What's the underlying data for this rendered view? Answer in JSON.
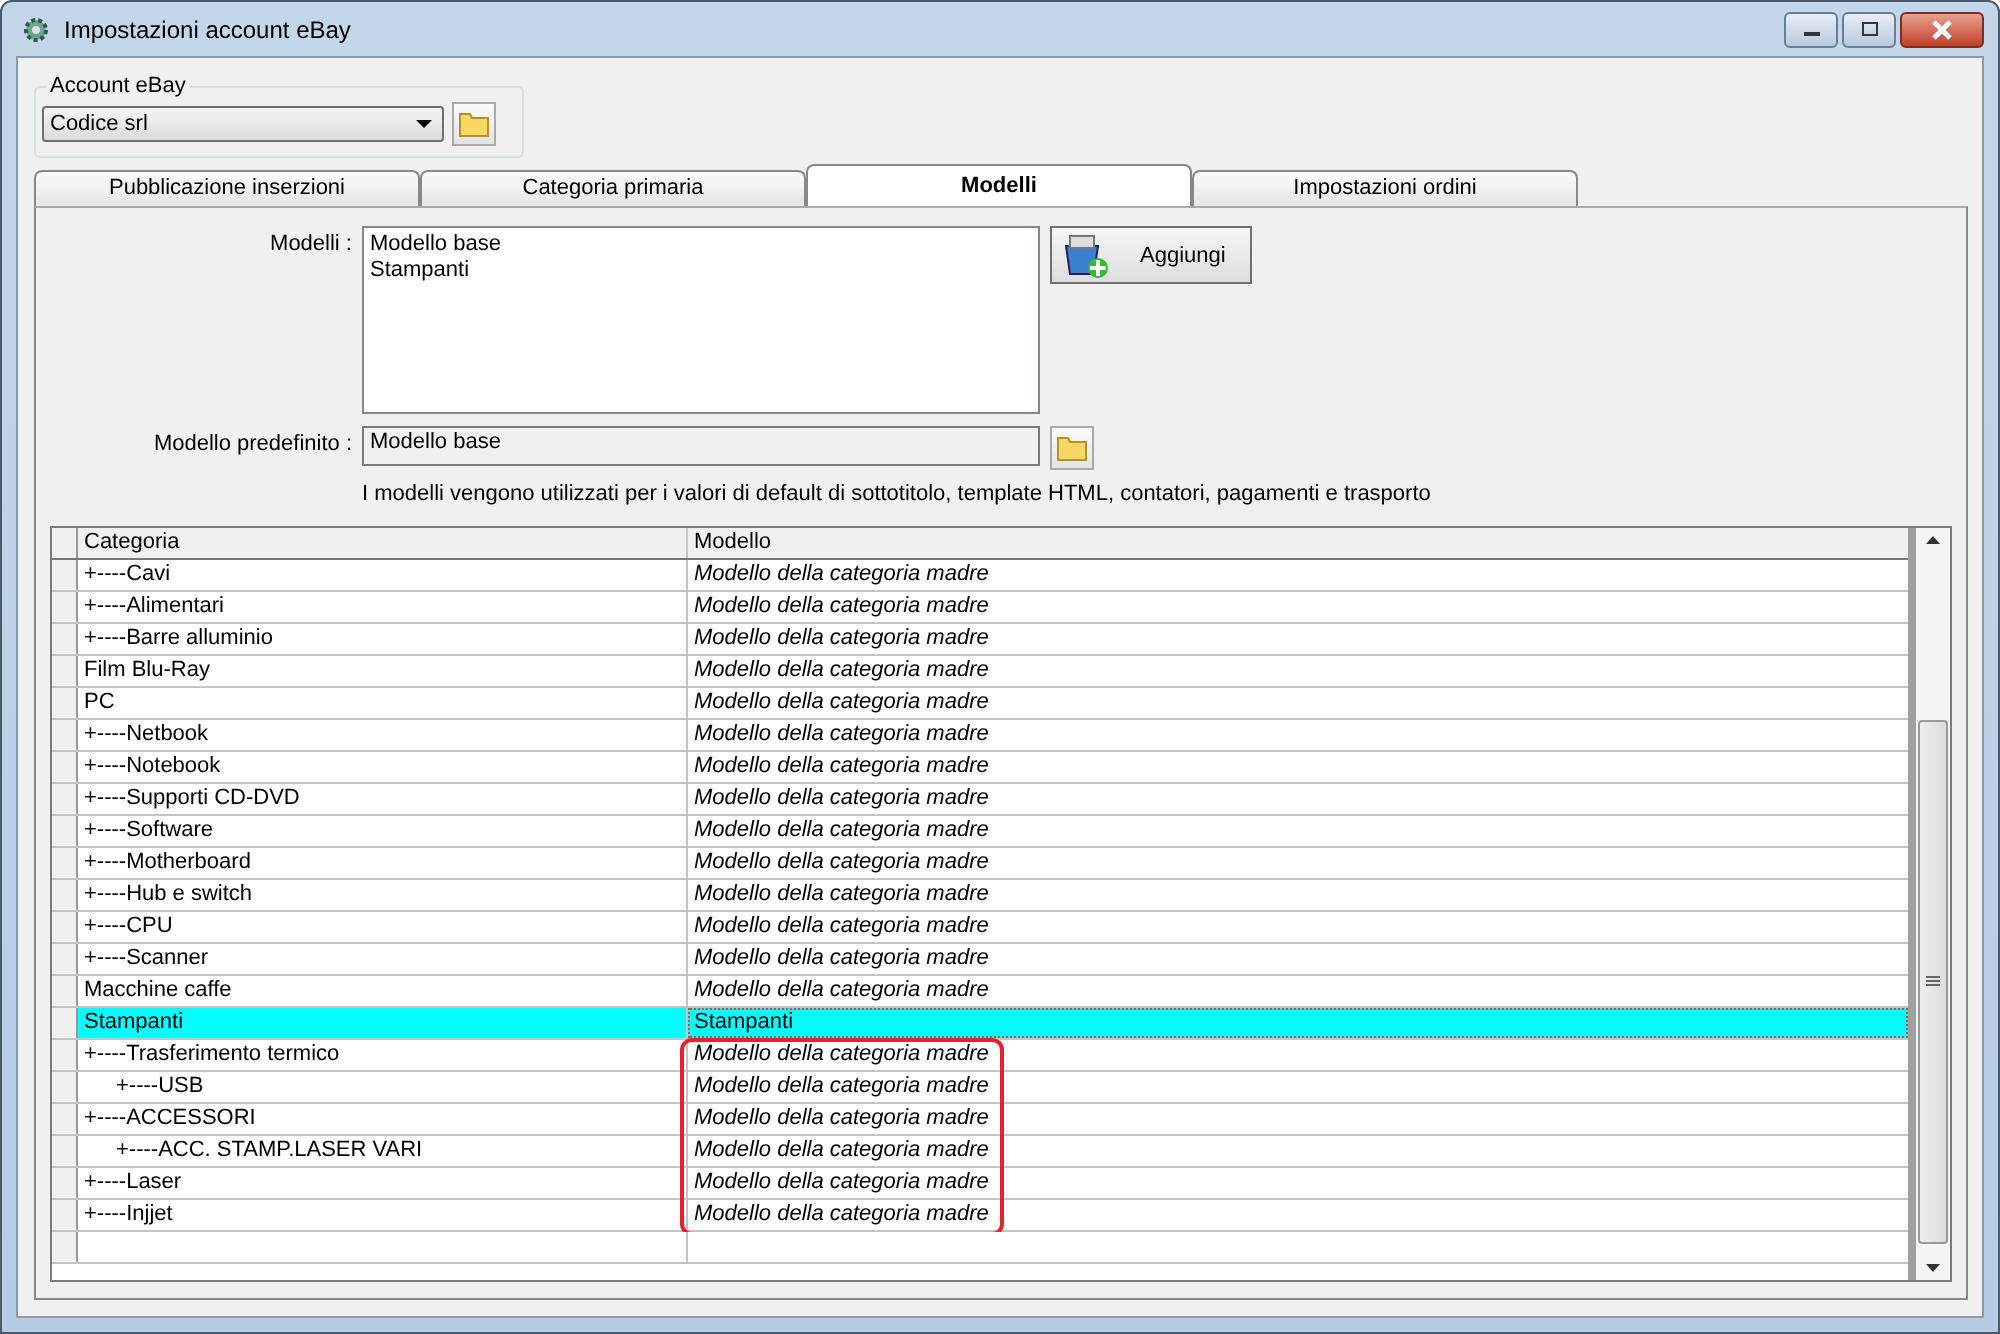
{
  "window": {
    "title": "Impostazioni account eBay"
  },
  "account_group": {
    "legend": "Account eBay",
    "account_select": {
      "value": "Codice srl"
    }
  },
  "tabs": [
    {
      "label": "Pubblicazione inserzioni",
      "selected": false
    },
    {
      "label": "Categoria primaria",
      "selected": false
    },
    {
      "label": "Modelli",
      "selected": true
    },
    {
      "label": "Impostazioni ordini",
      "selected": false
    }
  ],
  "models_panel": {
    "models_label": "Modelli :",
    "models_list": [
      "Modello base",
      "Stampanti"
    ],
    "add_button": "Aggiungi",
    "default_label": "Modello predefinito :",
    "default_value": "Modello base",
    "note": "I modelli vengono utilizzati per i valori di default di sottotitolo, template HTML, contatori, pagamenti e trasporto"
  },
  "table": {
    "columns": [
      "Categoria",
      "Modello"
    ],
    "rows": [
      {
        "category": "+----Cavi",
        "model": "Modello della categoria madre",
        "inherited": true,
        "selected": false,
        "outlined": false
      },
      {
        "category": "+----Alimentari",
        "model": "Modello della categoria madre",
        "inherited": true,
        "selected": false,
        "outlined": false
      },
      {
        "category": "+----Barre alluminio",
        "model": "Modello della categoria madre",
        "inherited": true,
        "selected": false,
        "outlined": false
      },
      {
        "category": "Film Blu-Ray",
        "model": "Modello della categoria madre",
        "inherited": true,
        "selected": false,
        "outlined": false
      },
      {
        "category": "PC",
        "model": "Modello della categoria madre",
        "inherited": true,
        "selected": false,
        "outlined": false
      },
      {
        "category": "+----Netbook",
        "model": "Modello della categoria madre",
        "inherited": true,
        "selected": false,
        "outlined": false
      },
      {
        "category": "+----Notebook",
        "model": "Modello della categoria madre",
        "inherited": true,
        "selected": false,
        "outlined": false
      },
      {
        "category": "+----Supporti CD-DVD",
        "model": "Modello della categoria madre",
        "inherited": true,
        "selected": false,
        "outlined": false
      },
      {
        "category": "+----Software",
        "model": "Modello della categoria madre",
        "inherited": true,
        "selected": false,
        "outlined": false
      },
      {
        "category": "+----Motherboard",
        "model": "Modello della categoria madre",
        "inherited": true,
        "selected": false,
        "outlined": false
      },
      {
        "category": "+----Hub e switch",
        "model": "Modello della categoria madre",
        "inherited": true,
        "selected": false,
        "outlined": false
      },
      {
        "category": "+----CPU",
        "model": "Modello della categoria madre",
        "inherited": true,
        "selected": false,
        "outlined": false
      },
      {
        "category": "+----Scanner",
        "model": "Modello della categoria madre",
        "inherited": true,
        "selected": false,
        "outlined": false
      },
      {
        "category": "Macchine caffe",
        "model": "Modello della categoria madre",
        "inherited": true,
        "selected": false,
        "outlined": false
      },
      {
        "category": "Stampanti",
        "model": "Stampanti",
        "inherited": false,
        "selected": true,
        "outlined": false
      },
      {
        "category": "+----Trasferimento termico",
        "model": "Modello della categoria madre",
        "inherited": true,
        "selected": false,
        "outlined": true,
        "children": [
          {
            "category": "+----USB",
            "model": "Modello della categoria madre",
            "inherited": true,
            "selected": false,
            "outlined": true
          }
        ]
      },
      {
        "category": "+----ACCESSORI",
        "model": "Modello della categoria madre",
        "inherited": true,
        "selected": false,
        "outlined": true,
        "children": [
          {
            "category": "+----ACC. STAMP.LASER VARI",
            "model": "Modello della categoria madre",
            "inherited": true,
            "selected": false,
            "outlined": true
          }
        ]
      },
      {
        "category": "+----Laser",
        "model": "Modello della categoria madre",
        "inherited": true,
        "selected": false,
        "outlined": true
      },
      {
        "category": "+----Injjet",
        "model": "Modello della categoria madre",
        "inherited": true,
        "selected": false,
        "outlined": true
      }
    ]
  }
}
